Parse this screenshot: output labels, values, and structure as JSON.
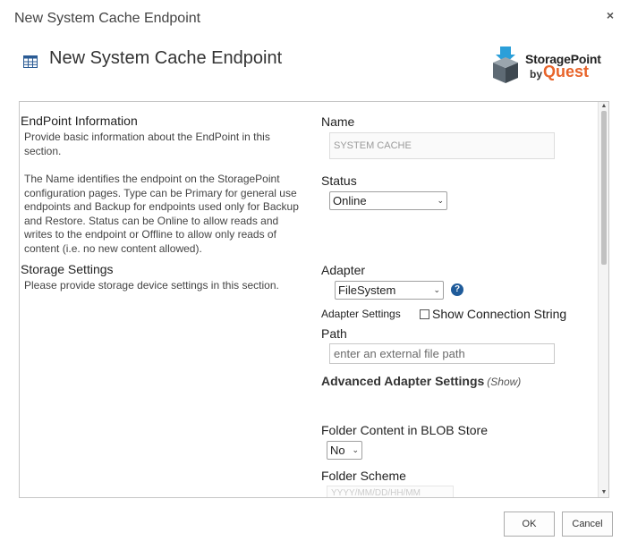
{
  "dialog": {
    "title": "New System Cache Endpoint",
    "close_symbol": "×"
  },
  "header": {
    "title": "New System Cache Endpoint",
    "icon": "list-grid-icon"
  },
  "logo": {
    "line1": "StoragePoint",
    "by": "by",
    "brand": "Quest",
    "icon": "storagepoint-box-icon",
    "accent_color": "#e8642a",
    "icon_color": "#2b9fd9"
  },
  "sections": {
    "endpoint": {
      "heading": "EndPoint Information",
      "desc1": "Provide basic information about the EndPoint in this section.",
      "desc2": "The Name identifies the endpoint on the StoragePoint configuration pages. Type can be Primary for general use endpoints and Backup for endpoints used only for Backup and Restore. Status can be Online to allow reads and writes to the endpoint or Offline to allow only reads of content (i.e. no new content allowed)."
    },
    "storage": {
      "heading": "Storage Settings",
      "desc": "Please provide storage device settings in this section."
    }
  },
  "fields": {
    "name_label": "Name",
    "name_value": "SYSTEM CACHE",
    "status_label": "Status",
    "status_value": "Online",
    "adapter_label": "Adapter",
    "adapter_value": "FileSystem",
    "help_symbol": "?",
    "adapter_settings_label": "Adapter Settings",
    "show_connection_string": "Show Connection String",
    "path_label": "Path",
    "path_placeholder": "enter an external file path",
    "advanced_label": "Advanced Adapter Settings",
    "advanced_show": "(Show)",
    "folder_blob_label": "Folder Content in BLOB Store",
    "folder_blob_value": "No",
    "folder_scheme_label": "Folder Scheme",
    "folder_scheme_value": "YYYY/MM/DD/HH/MM"
  },
  "footer": {
    "ok_label": "OK",
    "cancel_label": "Cancel"
  }
}
